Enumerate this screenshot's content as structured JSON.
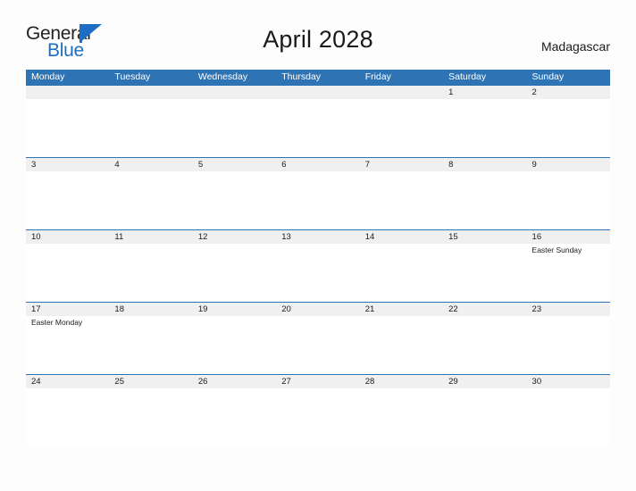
{
  "brand": {
    "name_part1": "General",
    "name_part2": "Blue",
    "triangle_color": "#1b6ec2"
  },
  "header": {
    "title": "April 2028",
    "locale": "Madagascar"
  },
  "theme": {
    "header_blue": "#2e74b5",
    "band_gray": "#f0f0f0",
    "page_background": "#fdfdfd",
    "text_dark": "#1a1a1a"
  },
  "calendar": {
    "weekdays": [
      "Monday",
      "Tuesday",
      "Wednesday",
      "Thursday",
      "Friday",
      "Saturday",
      "Sunday"
    ],
    "weeks": [
      [
        {
          "day": "",
          "event": ""
        },
        {
          "day": "",
          "event": ""
        },
        {
          "day": "",
          "event": ""
        },
        {
          "day": "",
          "event": ""
        },
        {
          "day": "",
          "event": ""
        },
        {
          "day": "1",
          "event": ""
        },
        {
          "day": "2",
          "event": ""
        }
      ],
      [
        {
          "day": "3",
          "event": ""
        },
        {
          "day": "4",
          "event": ""
        },
        {
          "day": "5",
          "event": ""
        },
        {
          "day": "6",
          "event": ""
        },
        {
          "day": "7",
          "event": ""
        },
        {
          "day": "8",
          "event": ""
        },
        {
          "day": "9",
          "event": ""
        }
      ],
      [
        {
          "day": "10",
          "event": ""
        },
        {
          "day": "11",
          "event": ""
        },
        {
          "day": "12",
          "event": ""
        },
        {
          "day": "13",
          "event": ""
        },
        {
          "day": "14",
          "event": ""
        },
        {
          "day": "15",
          "event": ""
        },
        {
          "day": "16",
          "event": "Easter Sunday"
        }
      ],
      [
        {
          "day": "17",
          "event": "Easter Monday"
        },
        {
          "day": "18",
          "event": ""
        },
        {
          "day": "19",
          "event": ""
        },
        {
          "day": "20",
          "event": ""
        },
        {
          "day": "21",
          "event": ""
        },
        {
          "day": "22",
          "event": ""
        },
        {
          "day": "23",
          "event": ""
        }
      ],
      [
        {
          "day": "24",
          "event": ""
        },
        {
          "day": "25",
          "event": ""
        },
        {
          "day": "26",
          "event": ""
        },
        {
          "day": "27",
          "event": ""
        },
        {
          "day": "28",
          "event": ""
        },
        {
          "day": "29",
          "event": ""
        },
        {
          "day": "30",
          "event": ""
        }
      ]
    ]
  }
}
